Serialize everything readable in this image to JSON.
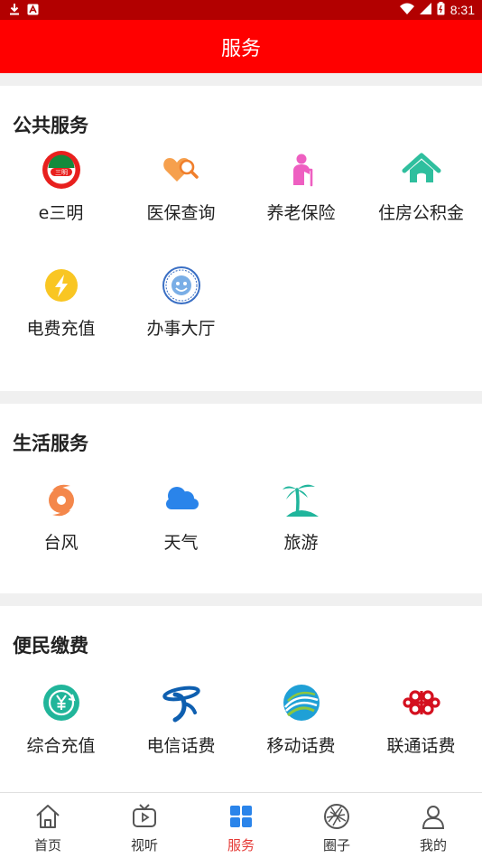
{
  "status_bar": {
    "time": "8:31"
  },
  "header": {
    "title": "服务"
  },
  "sections": [
    {
      "title": "公共服务",
      "items": [
        {
          "label": "e三明",
          "icon": "e-sanming-logo-icon",
          "badge_text": "三明"
        },
        {
          "label": "医保查询",
          "icon": "medical-insurance-search-icon"
        },
        {
          "label": "养老保险",
          "icon": "elderly-pension-icon"
        },
        {
          "label": "住房公积金",
          "icon": "house-fund-icon"
        },
        {
          "label": "电费充值",
          "icon": "lightning-icon"
        },
        {
          "label": "办事大厅",
          "icon": "service-hall-seal-icon"
        }
      ]
    },
    {
      "title": "生活服务",
      "items": [
        {
          "label": "台风",
          "icon": "typhoon-icon"
        },
        {
          "label": "天气",
          "icon": "weather-cloud-icon"
        },
        {
          "label": "旅游",
          "icon": "palm-tree-icon"
        }
      ]
    },
    {
      "title": "便民缴费",
      "items": [
        {
          "label": "综合充值",
          "icon": "yuan-recharge-icon"
        },
        {
          "label": "电信话费",
          "icon": "china-telecom-icon"
        },
        {
          "label": "移动话费",
          "icon": "china-mobile-icon"
        },
        {
          "label": "联通话费",
          "icon": "china-unicom-icon"
        }
      ]
    }
  ],
  "bottom_nav": [
    {
      "label": "首页",
      "icon": "home-icon",
      "active": false
    },
    {
      "label": "视听",
      "icon": "tv-icon",
      "active": false
    },
    {
      "label": "服务",
      "icon": "grid-icon",
      "active": true
    },
    {
      "label": "圈子",
      "icon": "aperture-icon",
      "active": false
    },
    {
      "label": "我的",
      "icon": "user-icon",
      "active": false
    }
  ],
  "colors": {
    "status_bar": "#b20000",
    "header": "#ff0000",
    "active_tab": "#e53935",
    "inactive_tab": "#555555"
  }
}
